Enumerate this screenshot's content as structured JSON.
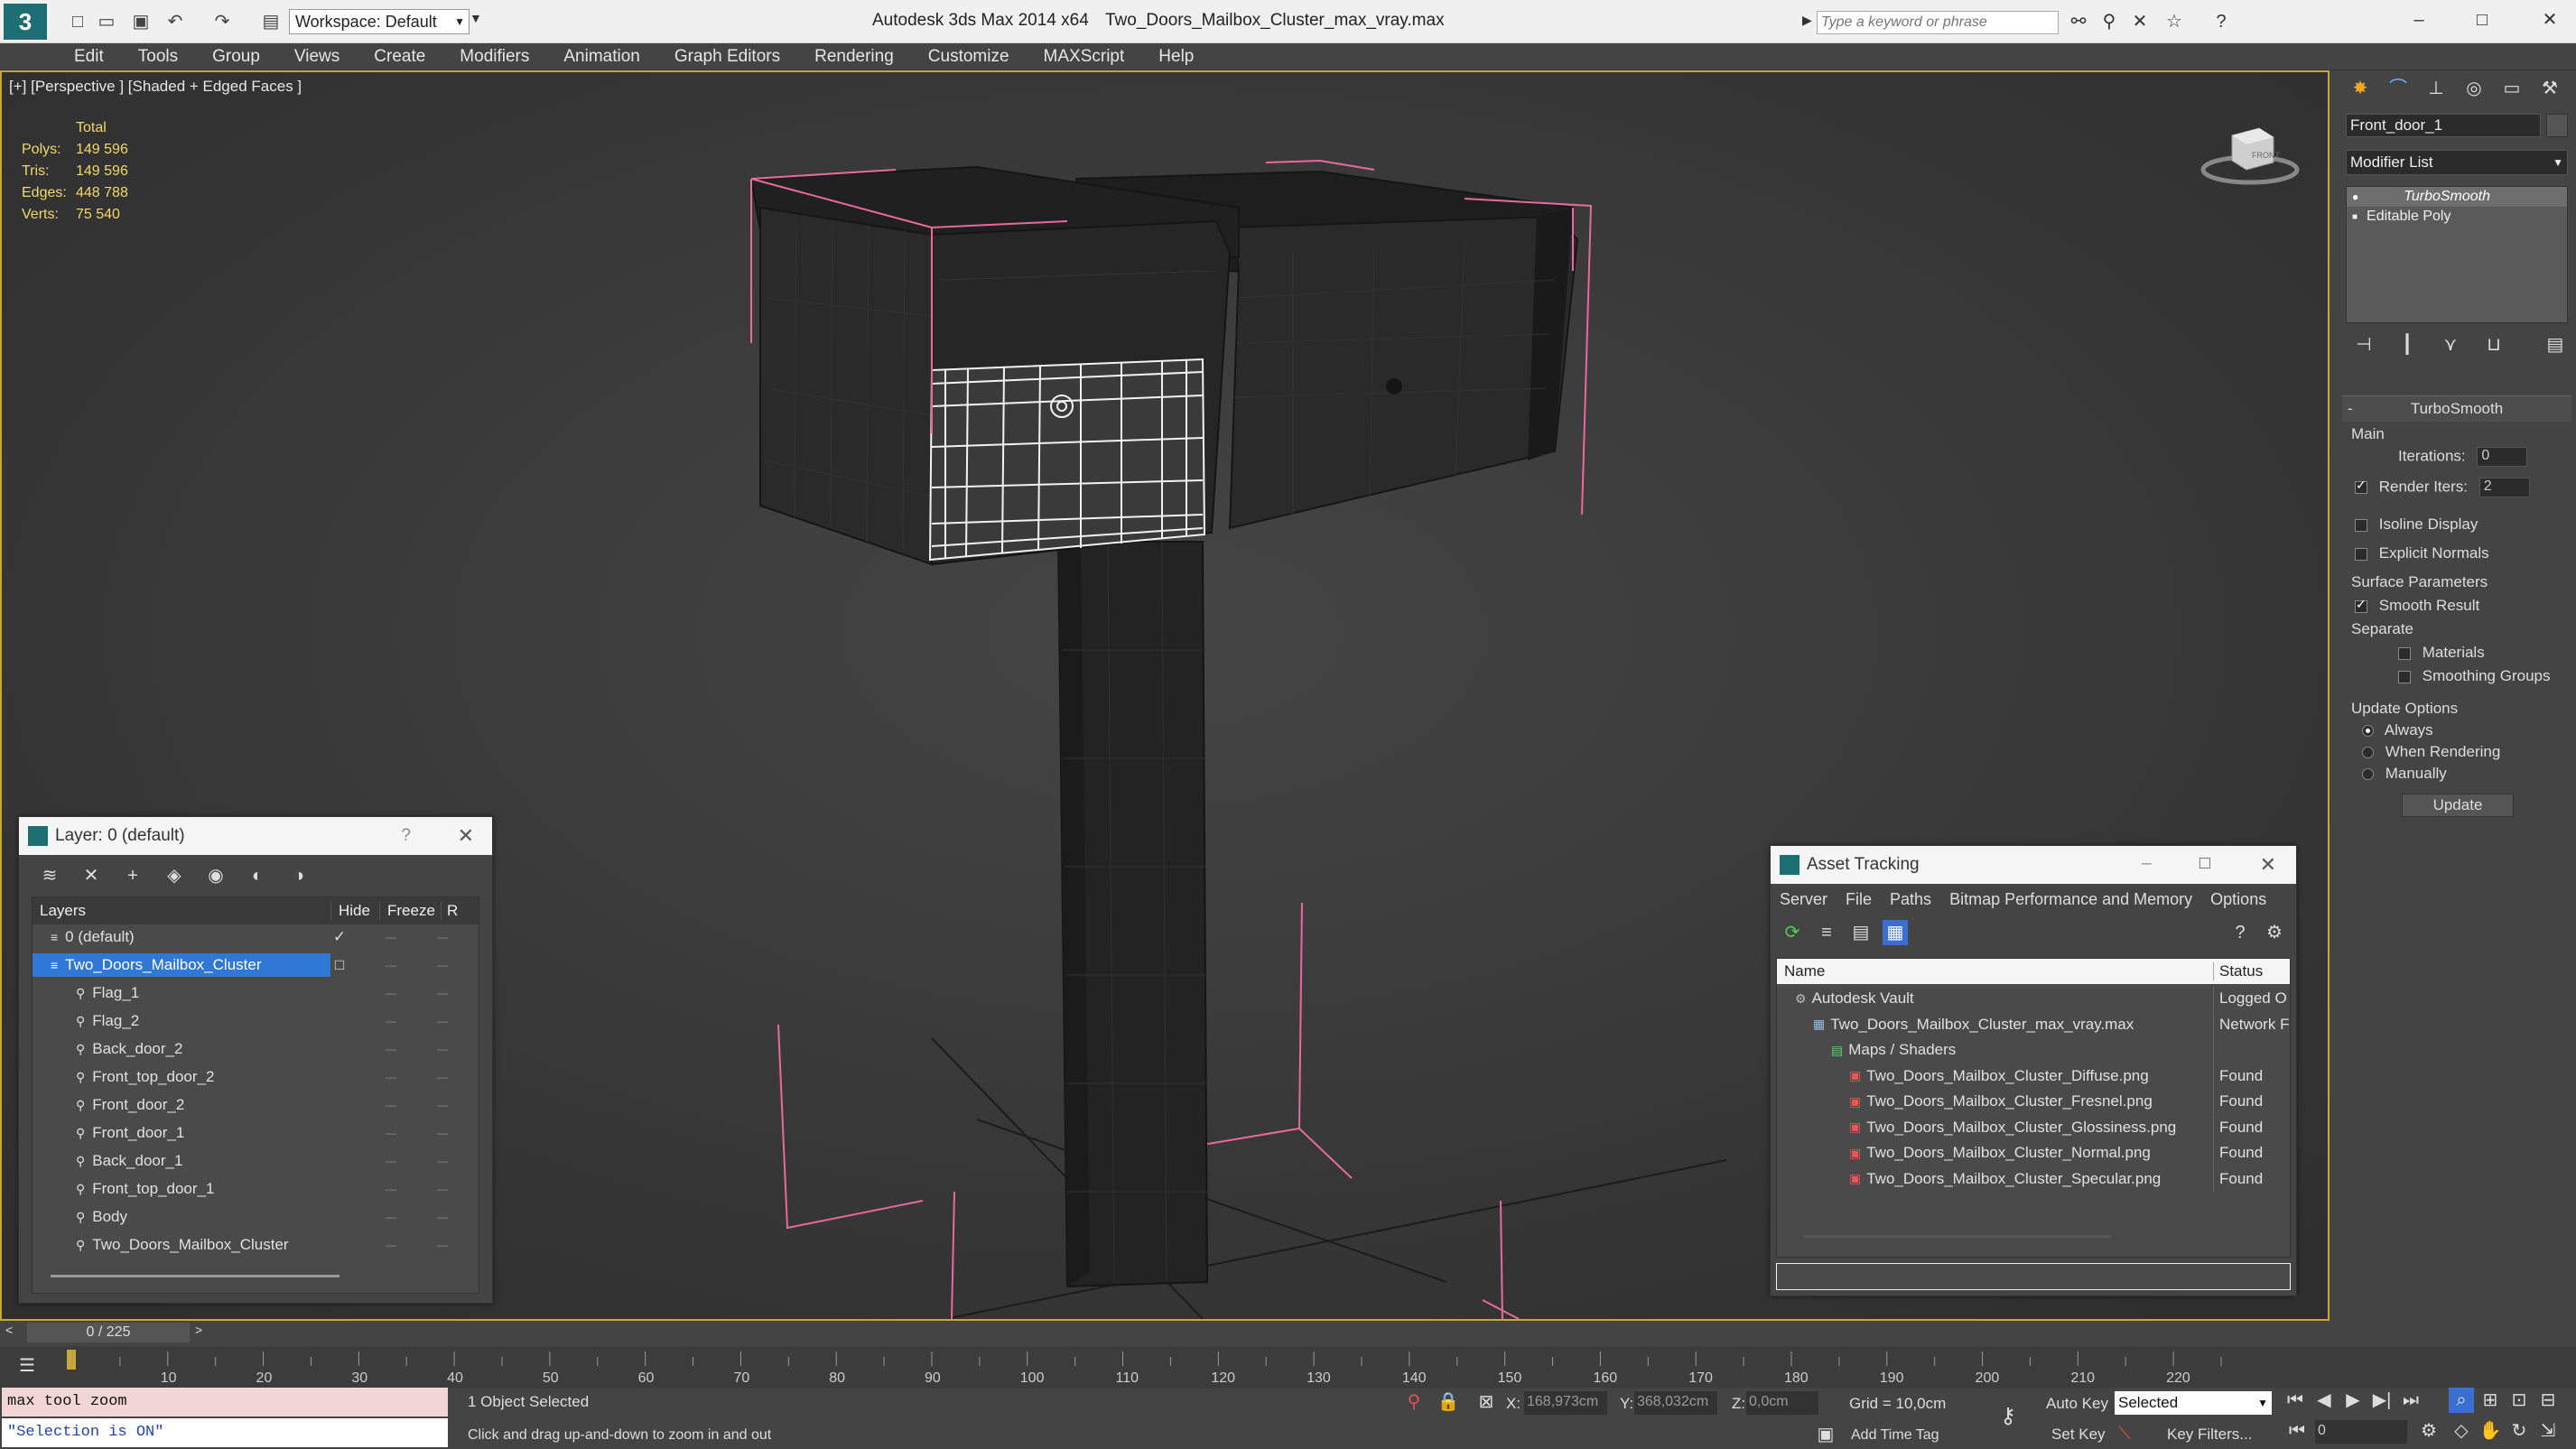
{
  "titlebar": {
    "app_title": "Autodesk 3ds Max  2014 x64",
    "file_title": "Two_Doors_Mailbox_Cluster_max_vray.max",
    "workspace_label": "Workspace: Default",
    "search_placeholder": "Type a keyword or phrase"
  },
  "menu": [
    "Edit",
    "Tools",
    "Group",
    "Views",
    "Create",
    "Modifiers",
    "Animation",
    "Graph Editors",
    "Rendering",
    "Customize",
    "MAXScript",
    "Help"
  ],
  "viewport": {
    "label": "[+] [Perspective ] [Shaded + Edged Faces ]",
    "stats": {
      "header": "Total",
      "rows": [
        {
          "label": "Polys:",
          "value": "149 596"
        },
        {
          "label": "Tris:",
          "value": "149 596"
        },
        {
          "label": "Edges:",
          "value": "448 788"
        },
        {
          "label": "Verts:",
          "value": "75 540"
        }
      ]
    },
    "viewcube_label": "FRONT"
  },
  "cmdpanel": {
    "object_name": "Front_door_1",
    "modifier_list_label": "Modifier List",
    "stack": [
      "TurboSmooth",
      "Editable Poly"
    ],
    "rollout_title": "TurboSmooth",
    "main_label": "Main",
    "iterations_label": "Iterations:",
    "iterations_value": "0",
    "render_iters_label": "Render Iters:",
    "render_iters_value": "2",
    "isoline_label": "Isoline Display",
    "explicit_normals_label": "Explicit Normals",
    "surface_params_label": "Surface Parameters",
    "smooth_result_label": "Smooth Result",
    "separate_label": "Separate",
    "materials_label": "Materials",
    "smoothing_groups_label": "Smoothing Groups",
    "update_options_label": "Update Options",
    "always_label": "Always",
    "when_rendering_label": "When Rendering",
    "manually_label": "Manually",
    "update_button": "Update"
  },
  "layer_panel": {
    "title": "Layer: 0 (default)",
    "help_glyph": "?",
    "columns": [
      "Layers",
      "Hide",
      "Freeze",
      "R"
    ],
    "rows": [
      {
        "name": "0 (default)",
        "indent": 0,
        "selected": false
      },
      {
        "name": "Two_Doors_Mailbox_Cluster",
        "indent": 0,
        "selected": true
      },
      {
        "name": "Flag_1",
        "indent": 1,
        "selected": false
      },
      {
        "name": "Flag_2",
        "indent": 1,
        "selected": false
      },
      {
        "name": "Back_door_2",
        "indent": 1,
        "selected": false
      },
      {
        "name": "Front_top_door_2",
        "indent": 1,
        "selected": false
      },
      {
        "name": "Front_door_2",
        "indent": 1,
        "selected": false
      },
      {
        "name": "Front_door_1",
        "indent": 1,
        "selected": false
      },
      {
        "name": "Back_door_1",
        "indent": 1,
        "selected": false
      },
      {
        "name": "Front_top_door_1",
        "indent": 1,
        "selected": false
      },
      {
        "name": "Body",
        "indent": 1,
        "selected": false
      },
      {
        "name": "Two_Doors_Mailbox_Cluster",
        "indent": 1,
        "selected": false
      }
    ]
  },
  "asset_panel": {
    "title": "Asset Tracking",
    "menu": [
      "Server",
      "File",
      "Paths",
      "Bitmap Performance and Memory",
      "Options"
    ],
    "columns": [
      "Name",
      "Status"
    ],
    "rows": [
      {
        "name": "Autodesk Vault",
        "status": "Logged O",
        "indent": 1
      },
      {
        "name": "Two_Doors_Mailbox_Cluster_max_vray.max",
        "status": "Network F",
        "indent": 2
      },
      {
        "name": "Maps / Shaders",
        "status": "",
        "indent": 3
      },
      {
        "name": "Two_Doors_Mailbox_Cluster_Diffuse.png",
        "status": "Found",
        "indent": 4
      },
      {
        "name": "Two_Doors_Mailbox_Cluster_Fresnel.png",
        "status": "Found",
        "indent": 4
      },
      {
        "name": "Two_Doors_Mailbox_Cluster_Glossiness.png",
        "status": "Found",
        "indent": 4
      },
      {
        "name": "Two_Doors_Mailbox_Cluster_Normal.png",
        "status": "Found",
        "indent": 4
      },
      {
        "name": "Two_Doors_Mailbox_Cluster_Specular.png",
        "status": "Found",
        "indent": 4
      }
    ]
  },
  "timeline": {
    "frame_label": "0 / 225",
    "ticks": [
      "10",
      "20",
      "30",
      "40",
      "50",
      "60",
      "70",
      "80",
      "90",
      "100",
      "110",
      "120",
      "130",
      "140",
      "150",
      "160",
      "170",
      "180",
      "190",
      "200",
      "210",
      "220"
    ]
  },
  "status": {
    "script_line1": "max tool zoom",
    "script_line2": "\"Selection is ON\"",
    "selected_count": "1 Object Selected",
    "prompt": "Click and drag up-and-down to zoom in and out",
    "x_label": "X:",
    "x_value": "168,973cm",
    "y_label": "Y:",
    "y_value": "368,032cm",
    "z_label": "Z:",
    "z_value": "0,0cm",
    "grid": "Grid = 10,0cm",
    "auto_key": "Auto Key",
    "selected_dropdown": "Selected",
    "set_key": "Set Key",
    "key_filters": "Key Filters...",
    "add_time_tag": "Add Time Tag",
    "frame_value": "0"
  }
}
